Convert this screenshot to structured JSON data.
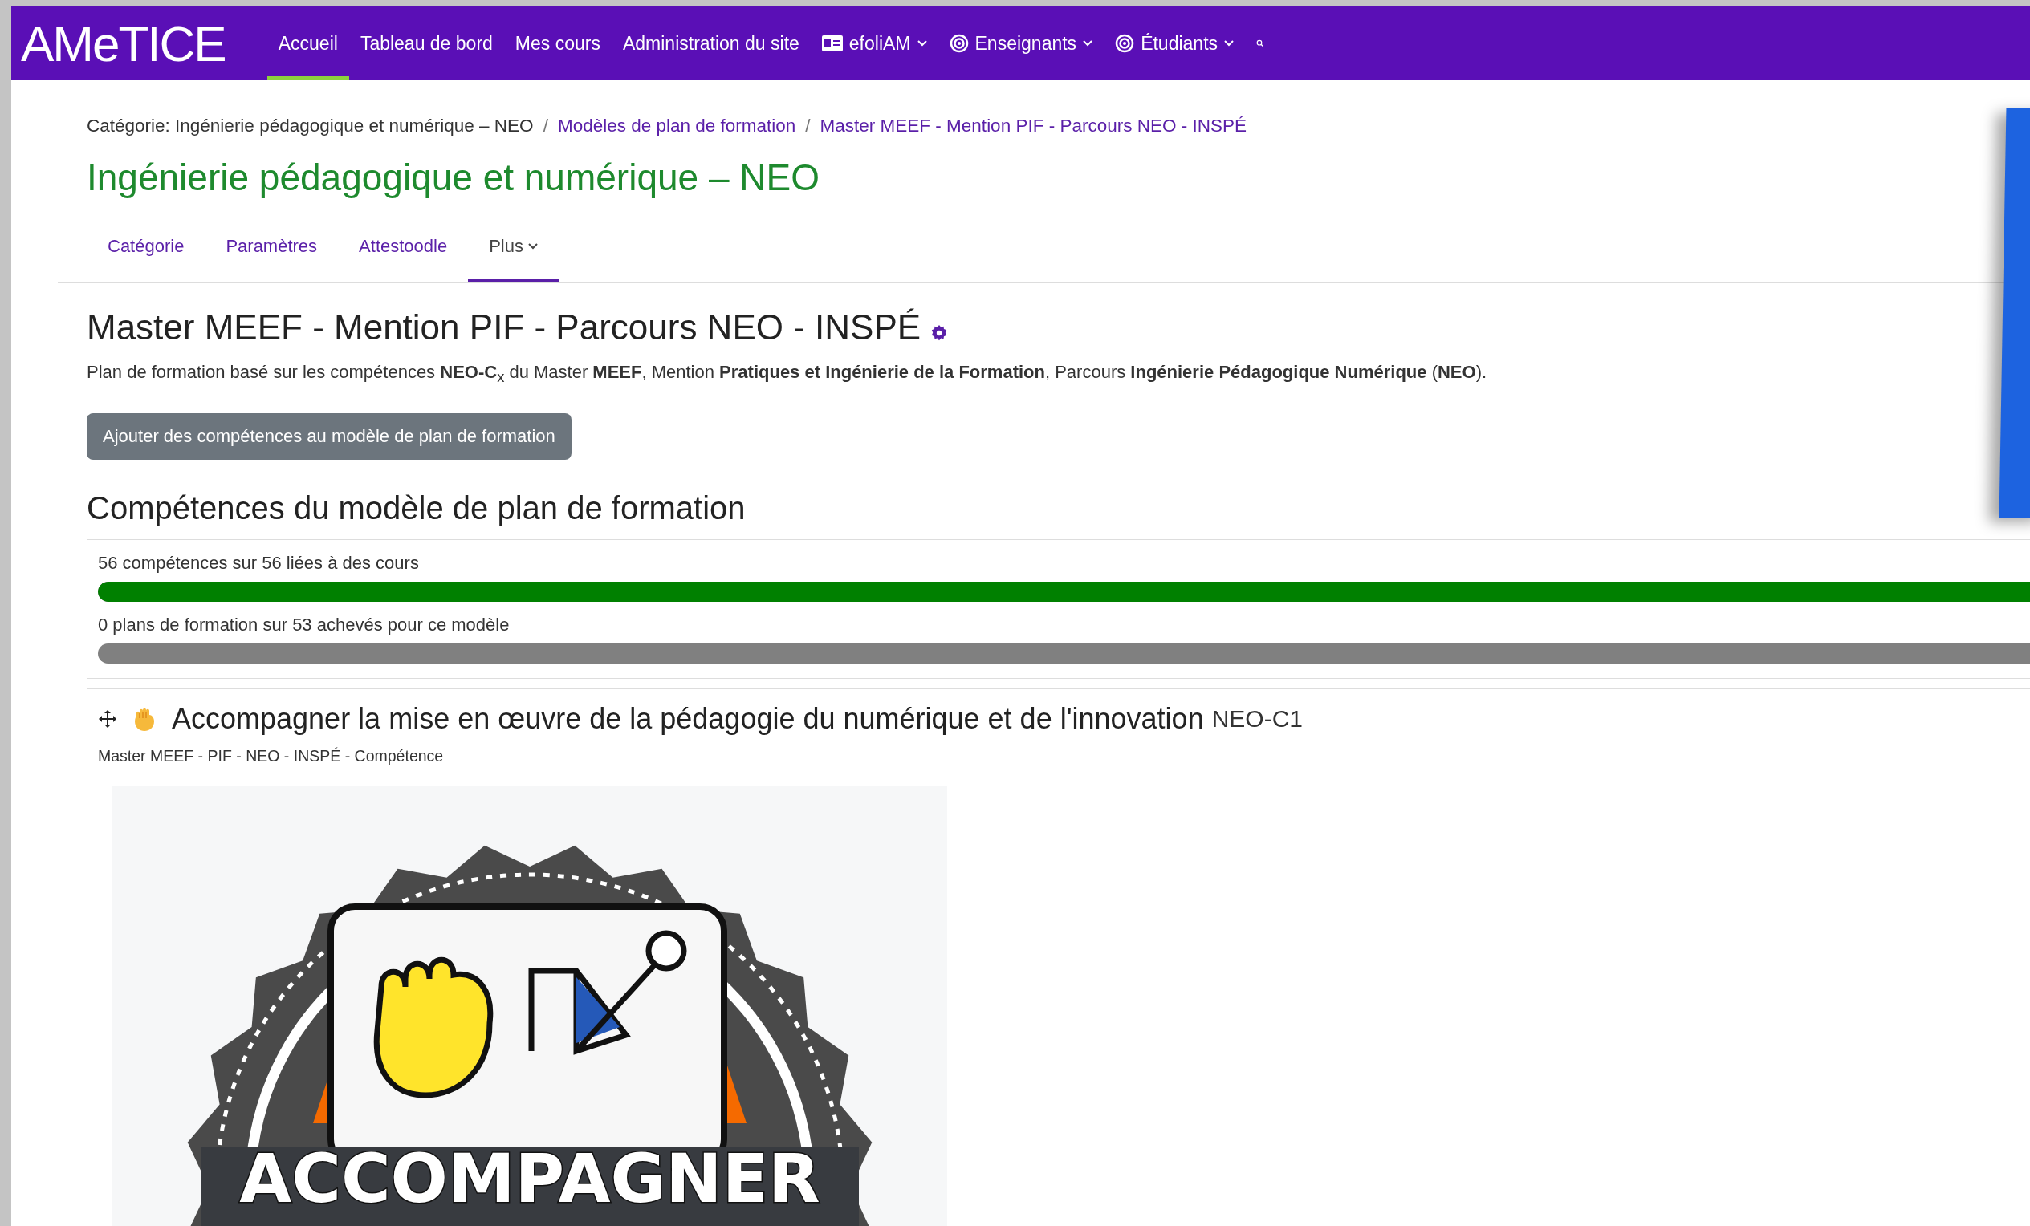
{
  "navbar": {
    "logo": "AMeTICE",
    "items": [
      {
        "label": "Accueil",
        "kind": "link",
        "selected": true
      },
      {
        "label": "Tableau de bord",
        "kind": "link",
        "selected": false
      },
      {
        "label": "Mes cours",
        "kind": "link",
        "selected": false
      },
      {
        "label": "Administration du site",
        "kind": "link",
        "selected": false
      },
      {
        "label": "efoliAM",
        "kind": "card-menu",
        "selected": false
      },
      {
        "label": "Enseignants",
        "kind": "target-menu",
        "selected": false
      },
      {
        "label": "Étudiants",
        "kind": "target-menu",
        "selected": false
      }
    ]
  },
  "breadcrumb": [
    {
      "label": "Catégorie: Ingénierie pédagogique et numérique – NEO",
      "kind": "text"
    },
    {
      "label": "/",
      "kind": "separator"
    },
    {
      "label": "Modèles de plan de formation",
      "kind": "link"
    },
    {
      "label": "/",
      "kind": "separator"
    },
    {
      "label": "Master MEEF - Mention PIF - Parcours NEO - INSPÉ",
      "kind": "link"
    }
  ],
  "page_title": "Ingénierie pédagogique et numérique – NEO",
  "tabs": [
    {
      "label": "Catégorie",
      "selected": false,
      "dropdown": false
    },
    {
      "label": "Paramètres",
      "selected": false,
      "dropdown": false
    },
    {
      "label": "Attestoodle",
      "selected": false,
      "dropdown": false
    },
    {
      "label": "Plus",
      "selected": true,
      "dropdown": true
    }
  ],
  "template": {
    "title": "Master MEEF - Mention PIF - Parcours NEO - INSPÉ",
    "description": "Plan de formation basé sur les compétences **NEO-C**$_{x}$ du Master **MEEF**, Mention **Pratiques et Ingénierie de la Formation**, Parcours **Ingénierie Pédagogique Numérique** (**NEO**).",
    "add_button": "Ajouter des compétences au modèle de plan de formation"
  },
  "competencies_heading": "Compétences du modèle de plan de formation",
  "progress": [
    {
      "label": "56 compétences sur 56 liées à des cours",
      "level": 1
    },
    {
      "label": "0 plans de formation sur 53 achevés pour ce modèle",
      "level": 0
    }
  ],
  "competency": {
    "title": "Accompagner la mise en œuvre de la pédagogie du numérique et de l'innovation",
    "code": "NEO-C1",
    "path": "Master MEEF - PIF - NEO - INSPÉ - Compétence",
    "badge_label": "ACCOMPAGNER"
  }
}
